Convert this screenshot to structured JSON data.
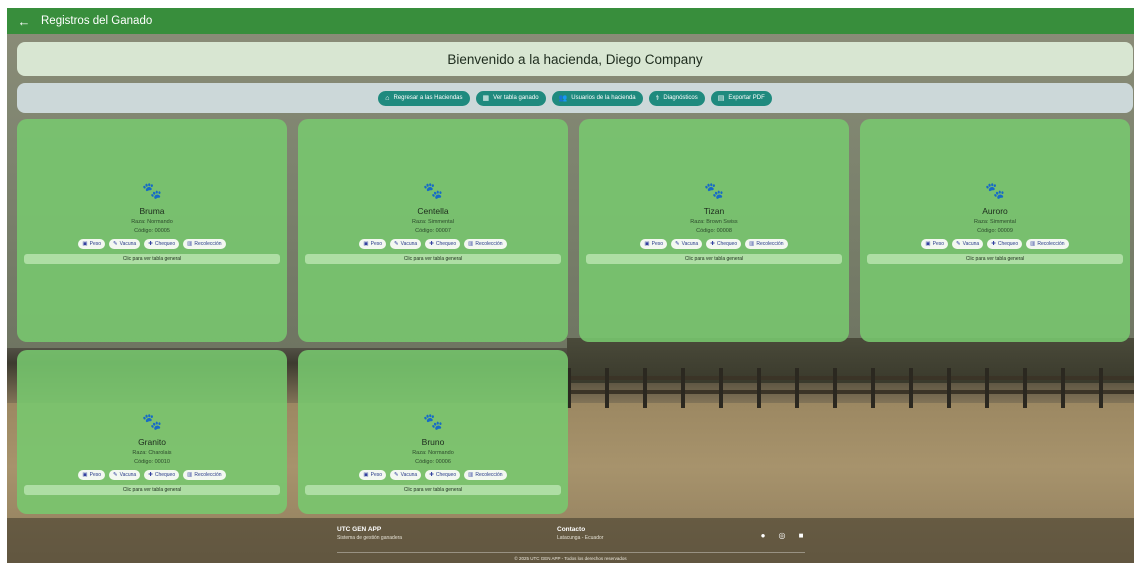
{
  "topbar": {
    "back_icon": "←",
    "title": "Registros del Ganado"
  },
  "welcome": {
    "text": "Bienvenido a la hacienda, Diego Company"
  },
  "toolbar": {
    "buttons": [
      {
        "icon": "⌂",
        "label": "Regresar a las Haciendas"
      },
      {
        "icon": "▦",
        "label": "Ver tabla ganado"
      },
      {
        "icon": "👥",
        "label": "Usuarios de la hacienda"
      },
      {
        "icon": "⚕",
        "label": "Diagnósticos"
      },
      {
        "icon": "▤",
        "label": "Exportar PDF"
      }
    ]
  },
  "card_actions": {
    "peso": {
      "icon": "▣",
      "label": "Peso"
    },
    "vacuna": {
      "icon": "✎",
      "label": "Vacuna"
    },
    "chequeo": {
      "icon": "✚",
      "label": "Chequeo"
    },
    "recoleccion": {
      "icon": "▥",
      "label": "Recolección"
    },
    "link": "Clic para ver tabla general"
  },
  "cards": [
    {
      "icon": "🐾",
      "name": "Bruma",
      "raza": "Raza: Normando",
      "codigo": "Código: 00005"
    },
    {
      "icon": "🐾",
      "name": "Centella",
      "raza": "Raza: Simmental",
      "codigo": "Código: 00007"
    },
    {
      "icon": "🐾",
      "name": "Tizan",
      "raza": "Raza: Brown Swiss",
      "codigo": "Código: 00008"
    },
    {
      "icon": "🐾",
      "name": "Auroro",
      "raza": "Raza: Simmental",
      "codigo": "Código: 00009"
    },
    {
      "icon": "🐾",
      "name": "Granito",
      "raza": "Raza: Charolais",
      "codigo": "Código: 00010"
    },
    {
      "icon": "🐾",
      "name": "Bruno",
      "raza": "Raza: Normando",
      "codigo": "Código: 00006"
    }
  ],
  "footer": {
    "brand_title": "UTC GEN APP",
    "brand_sub": "Sistema de gestión ganadera",
    "contact_title": "Contacto",
    "contact_sub": "Latacunga - Ecuador",
    "icons": [
      "facebook-icon",
      "instagram-icon",
      "camera-icon"
    ],
    "copyright": "© 2025 UTC GEN APP - Todos los derechos reservados"
  }
}
